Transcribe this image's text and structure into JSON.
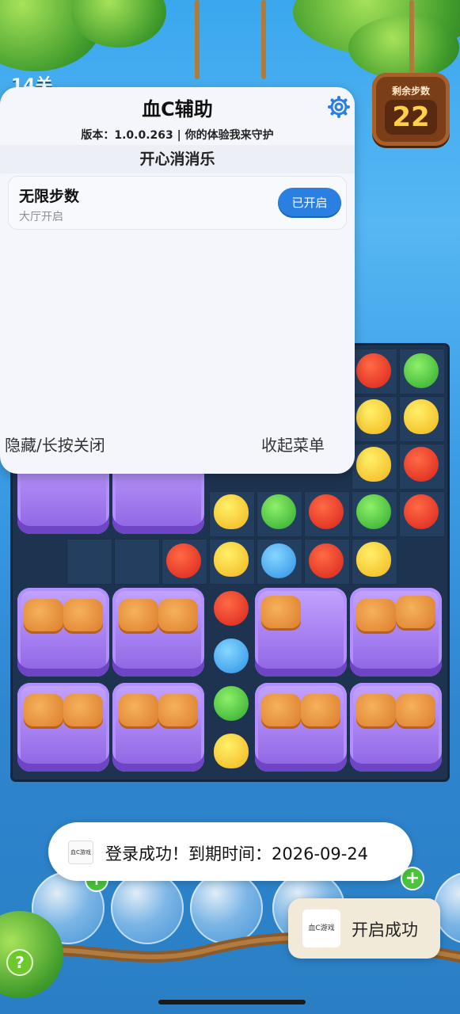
{
  "game": {
    "level_label": "14关",
    "steps_label": "剩余步数",
    "steps_value": "22"
  },
  "panel": {
    "title": "血C辅助",
    "version_line": "版本：1.0.0.263 | 你的体验我来守护",
    "game_name": "开心消消乐",
    "feature": {
      "name": "无限步数",
      "sub": "大厅开启",
      "button": "已开启"
    },
    "hide_label": "隐藏/长按关闭",
    "collapse_label": "收起菜单",
    "settings_icon": "gear-icon"
  },
  "toast": {
    "icon_text": "血C游戏",
    "message": "登录成功！到期时间：2026-09-24"
  },
  "toast2": {
    "icon_text": "血C游戏",
    "message": "开启成功"
  },
  "colors": {
    "accent": "#2b7fe0",
    "steps_bg": "#7a3f19",
    "steps_number": "#ffd24a",
    "crate": "#9b73ea",
    "board": "#1d3350"
  }
}
